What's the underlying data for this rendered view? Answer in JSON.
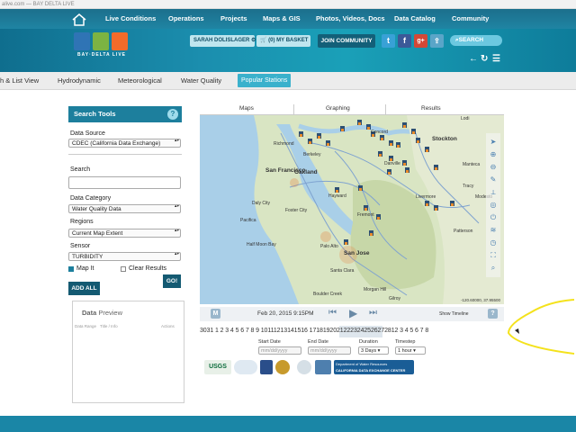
{
  "browser": {
    "url": "alive.com — BAY DELTA LIVE"
  },
  "topnav": {
    "items": [
      "Live Conditions",
      "Operations",
      "Projects",
      "Maps & GIS",
      "Photos, Videos, Docs",
      "Data Catalog",
      "Community"
    ]
  },
  "header": {
    "logo_text": "BAY·DELTA LIVE",
    "user": "SARAH DOLISLAGER",
    "basket": "(0) MY BASKET",
    "join": "JOIN COMMUNITY",
    "search": "SEARCH",
    "social": [
      "t",
      "f",
      "g+"
    ]
  },
  "subnav": {
    "items": [
      "h & List View",
      "Hydrodynamic",
      "Meteorological",
      "Water Quality",
      "Popular Stations"
    ]
  },
  "search_tools": {
    "title": "Search Tools",
    "help": "?",
    "data_source_label": "Data Source",
    "data_source_value": "CDEC (California Data Exchange)",
    "search_label": "Search",
    "data_category_label": "Data Category",
    "data_category_value": "Water Quality Data",
    "regions_label": "Regions",
    "regions_value": "Current Map Extent",
    "sensor_label": "Sensor",
    "sensor_value": "TURBIDITY",
    "map_it": "Map It",
    "map_it_checked": true,
    "clear_results": "Clear Results",
    "clear_results_checked": false,
    "add_all": "ADD ALL",
    "go": "GO!"
  },
  "data_preview": {
    "title_bold": "Data",
    "title_rest": " Preview",
    "columns": [
      "Data Range",
      "Title / Info",
      "Actions"
    ]
  },
  "map_tabs": [
    "Maps",
    "Graphing",
    "Results"
  ],
  "map": {
    "places": [
      {
        "name": "Richmond"
      },
      {
        "name": "Concord"
      },
      {
        "name": "Berkeley"
      },
      {
        "name": "Danville"
      },
      {
        "name": "Oakland"
      },
      {
        "name": "San Francisco"
      },
      {
        "name": "Livermore"
      },
      {
        "name": "Tracy"
      },
      {
        "name": "Hayward"
      },
      {
        "name": "Daly City"
      },
      {
        "name": "Foster City"
      },
      {
        "name": "Fremont"
      },
      {
        "name": "Palo Alto"
      },
      {
        "name": "San Jose"
      },
      {
        "name": "Stockton"
      },
      {
        "name": "Lodi"
      },
      {
        "name": "Manteca"
      },
      {
        "name": "Patterson"
      },
      {
        "name": "Modesto"
      },
      {
        "name": "Santa Clara"
      },
      {
        "name": "Half Moon Bay"
      },
      {
        "name": "Gilroy"
      },
      {
        "name": "Morgan Hill"
      },
      {
        "name": "Pacifica"
      },
      {
        "name": "Boulder Creek"
      }
    ],
    "coords_readout": "-120.60000, 37.95500"
  },
  "timeline": {
    "m_label": "M",
    "datetime": "Feb 20, 2015 9:15PM",
    "show_timeline": "Show Timeline",
    "help": "?"
  },
  "dates": "3031 1  2  3  4  5  6  7  8  9  10111213141516 17181920212223242526272812  3  4  5  6  7  8",
  "controls": {
    "start_label": "Start Date",
    "start_placeholder": "mm/dd/yyyy",
    "end_label": "End Date",
    "end_placeholder": "mm/dd/yyyy",
    "duration_label": "Duration",
    "duration_value": "3 Days",
    "timestep_label": "Timestep",
    "timestep_value": "1 hour"
  },
  "partner_logos": {
    "usgs": "USGS",
    "dwr_line1": "Department of Water Resources",
    "dwr_line2": "CALIFORNIA DATA EXCHANGE CENTER"
  },
  "colors": {
    "accent": "#1d7f9d",
    "nav": "#1c6f8c",
    "annotation": "#f4e21c"
  }
}
